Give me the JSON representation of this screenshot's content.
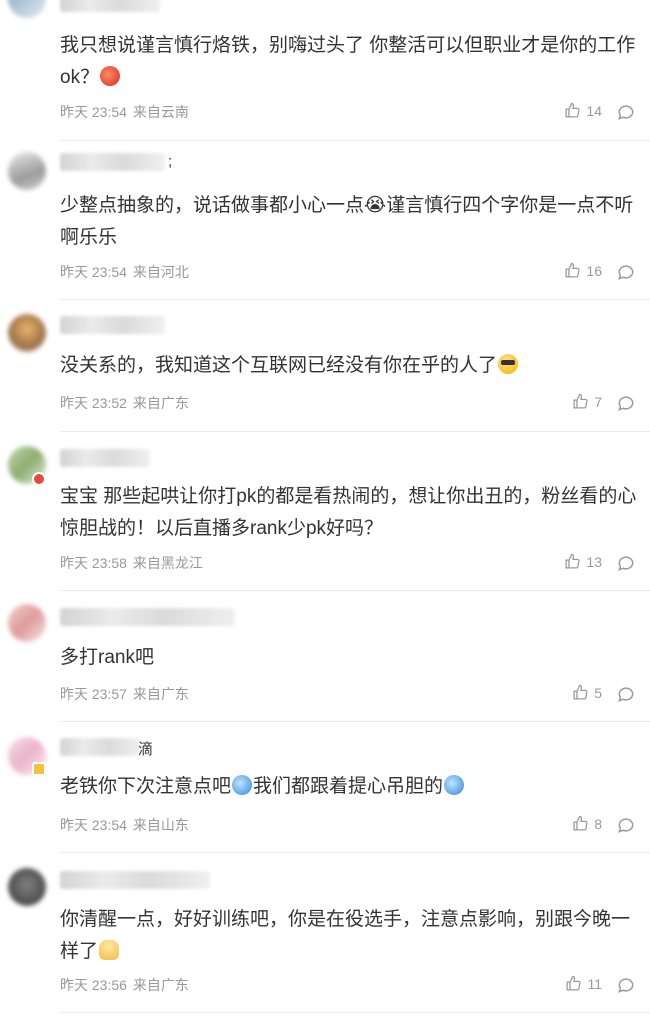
{
  "comments": [
    {
      "name_tail": "",
      "text": "我只想说谨言慎行烙铁，别嗨过头了 你整活可以但职业才是你的工作ok？",
      "emoji": "angry-face-emoji",
      "time": "昨天 23:54",
      "location": "来自云南",
      "likes": "14"
    },
    {
      "name_tail": ";",
      "text": "少整点抽象的，说话做事都小心一点😭谨言慎行四个字你是一点不听啊乐乐",
      "time": "昨天 23:54",
      "location": "来自河北",
      "likes": "16"
    },
    {
      "name_tail": "",
      "text": "没关系的，我知道这个互联网已经没有你在乎的人了",
      "emoji": "sunglasses-emoji",
      "time": "昨天 23:52",
      "location": "来自广东",
      "likes": "7"
    },
    {
      "name_tail": "",
      "text": "宝宝 那些起哄让你打pk的都是看热闹的，想让你出丑的，粉丝看的心惊胆战的！以后直播多rank少pk好吗？",
      "time": "昨天 23:58",
      "location": "来自黑龙江",
      "likes": "13"
    },
    {
      "name_tail": "",
      "text": "多打rank吧",
      "time": "昨天 23:57",
      "location": "来自广东",
      "likes": "5"
    },
    {
      "name_tail": "滴",
      "text": "老铁你下次注意点吧",
      "text2": "我们都跟着提心吊胆的",
      "time": "昨天 23:54",
      "location": "来自山东",
      "likes": "8"
    },
    {
      "name_tail": "",
      "text": "你清醒一点，好好训练吧，你是在役选手，注意点影响，别跟今晚一样了",
      "time": "昨天 23:56",
      "location": "来自广东",
      "likes": "11"
    }
  ],
  "icons": {
    "like": "thumbs-up-icon",
    "reply": "comment-bubble-icon"
  },
  "colors": {
    "text": "#333333",
    "meta": "#999999",
    "divider": "#ececec"
  }
}
